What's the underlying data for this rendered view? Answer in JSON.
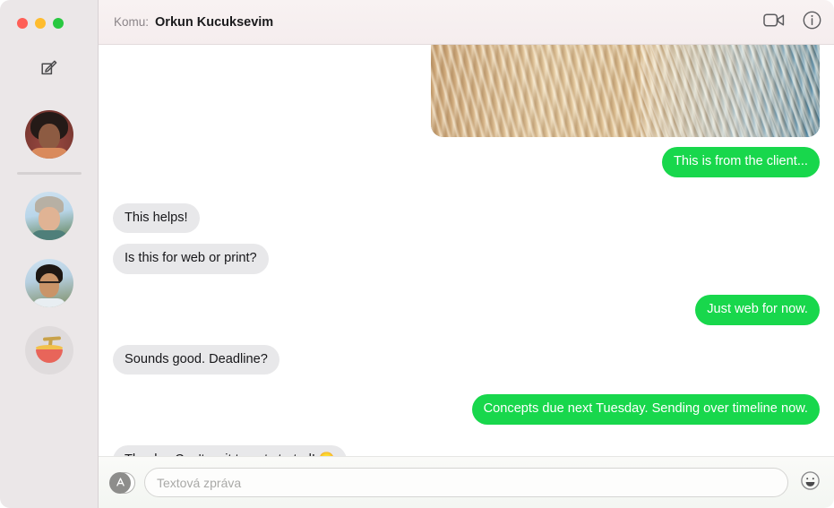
{
  "window": {
    "traffic_lights": [
      {
        "name": "close",
        "color": "#FF5F57"
      },
      {
        "name": "minimize",
        "color": "#FEBC2E"
      },
      {
        "name": "zoom",
        "color": "#28C840"
      }
    ]
  },
  "sidebar": {
    "compose_icon": "compose-icon",
    "background": "#EBE7E8",
    "conversations": [
      {
        "avatar_name": "avatar-person-afro",
        "selected": false
      },
      {
        "avatar_name": "avatar-person-beanie",
        "selected": false
      },
      {
        "avatar_name": "avatar-person-glasses",
        "selected": false
      },
      {
        "avatar_name": "avatar-ramen-bowl",
        "selected": false
      }
    ]
  },
  "header": {
    "to_label": "Komu:",
    "recipient": "Orkun Kucuksevim",
    "facetime_icon": "video-camera-icon",
    "info_icon": "info-circle-icon"
  },
  "conversation": {
    "bubble_colors": {
      "incoming": "#E8E8EA",
      "outgoing": "#18D74C"
    },
    "messages": [
      {
        "direction": "outgoing",
        "type": "image",
        "description": "photo of blonde hair against blue background"
      },
      {
        "direction": "outgoing",
        "type": "text",
        "text": "This is from the client..."
      },
      {
        "direction": "incoming",
        "type": "text",
        "text": "This helps!"
      },
      {
        "direction": "incoming",
        "type": "text",
        "text": "Is this for web or print?"
      },
      {
        "direction": "outgoing",
        "type": "text",
        "text": "Just web for now."
      },
      {
        "direction": "incoming",
        "type": "text",
        "text": "Sounds good. Deadline?"
      },
      {
        "direction": "outgoing",
        "type": "text",
        "text": "Concepts due next Tuesday. Sending over timeline now."
      },
      {
        "direction": "incoming",
        "type": "text",
        "text": "Thanks. Can't wait to get started! 😄"
      }
    ]
  },
  "composer": {
    "app_store_icon": "app-store-icon",
    "input_placeholder": "Textová zpráva",
    "input_value": "",
    "emoji_icon": "smiley-face-icon"
  }
}
